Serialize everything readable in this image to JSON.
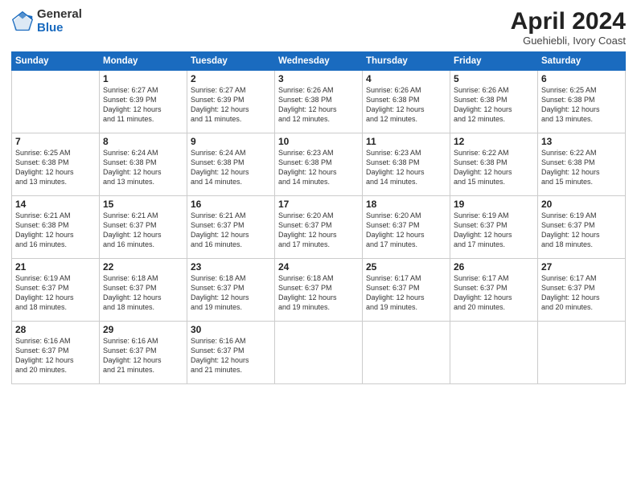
{
  "header": {
    "logo_general": "General",
    "logo_blue": "Blue",
    "month_title": "April 2024",
    "location": "Guehiebli, Ivory Coast"
  },
  "days_of_week": [
    "Sunday",
    "Monday",
    "Tuesday",
    "Wednesday",
    "Thursday",
    "Friday",
    "Saturday"
  ],
  "weeks": [
    [
      {
        "day": "",
        "info": ""
      },
      {
        "day": "1",
        "info": "Sunrise: 6:27 AM\nSunset: 6:39 PM\nDaylight: 12 hours\nand 11 minutes."
      },
      {
        "day": "2",
        "info": "Sunrise: 6:27 AM\nSunset: 6:39 PM\nDaylight: 12 hours\nand 11 minutes."
      },
      {
        "day": "3",
        "info": "Sunrise: 6:26 AM\nSunset: 6:38 PM\nDaylight: 12 hours\nand 12 minutes."
      },
      {
        "day": "4",
        "info": "Sunrise: 6:26 AM\nSunset: 6:38 PM\nDaylight: 12 hours\nand 12 minutes."
      },
      {
        "day": "5",
        "info": "Sunrise: 6:26 AM\nSunset: 6:38 PM\nDaylight: 12 hours\nand 12 minutes."
      },
      {
        "day": "6",
        "info": "Sunrise: 6:25 AM\nSunset: 6:38 PM\nDaylight: 12 hours\nand 13 minutes."
      }
    ],
    [
      {
        "day": "7",
        "info": "Sunrise: 6:25 AM\nSunset: 6:38 PM\nDaylight: 12 hours\nand 13 minutes."
      },
      {
        "day": "8",
        "info": "Sunrise: 6:24 AM\nSunset: 6:38 PM\nDaylight: 12 hours\nand 13 minutes."
      },
      {
        "day": "9",
        "info": "Sunrise: 6:24 AM\nSunset: 6:38 PM\nDaylight: 12 hours\nand 14 minutes."
      },
      {
        "day": "10",
        "info": "Sunrise: 6:23 AM\nSunset: 6:38 PM\nDaylight: 12 hours\nand 14 minutes."
      },
      {
        "day": "11",
        "info": "Sunrise: 6:23 AM\nSunset: 6:38 PM\nDaylight: 12 hours\nand 14 minutes."
      },
      {
        "day": "12",
        "info": "Sunrise: 6:22 AM\nSunset: 6:38 PM\nDaylight: 12 hours\nand 15 minutes."
      },
      {
        "day": "13",
        "info": "Sunrise: 6:22 AM\nSunset: 6:38 PM\nDaylight: 12 hours\nand 15 minutes."
      }
    ],
    [
      {
        "day": "14",
        "info": "Sunrise: 6:21 AM\nSunset: 6:38 PM\nDaylight: 12 hours\nand 16 minutes."
      },
      {
        "day": "15",
        "info": "Sunrise: 6:21 AM\nSunset: 6:37 PM\nDaylight: 12 hours\nand 16 minutes."
      },
      {
        "day": "16",
        "info": "Sunrise: 6:21 AM\nSunset: 6:37 PM\nDaylight: 12 hours\nand 16 minutes."
      },
      {
        "day": "17",
        "info": "Sunrise: 6:20 AM\nSunset: 6:37 PM\nDaylight: 12 hours\nand 17 minutes."
      },
      {
        "day": "18",
        "info": "Sunrise: 6:20 AM\nSunset: 6:37 PM\nDaylight: 12 hours\nand 17 minutes."
      },
      {
        "day": "19",
        "info": "Sunrise: 6:19 AM\nSunset: 6:37 PM\nDaylight: 12 hours\nand 17 minutes."
      },
      {
        "day": "20",
        "info": "Sunrise: 6:19 AM\nSunset: 6:37 PM\nDaylight: 12 hours\nand 18 minutes."
      }
    ],
    [
      {
        "day": "21",
        "info": "Sunrise: 6:19 AM\nSunset: 6:37 PM\nDaylight: 12 hours\nand 18 minutes."
      },
      {
        "day": "22",
        "info": "Sunrise: 6:18 AM\nSunset: 6:37 PM\nDaylight: 12 hours\nand 18 minutes."
      },
      {
        "day": "23",
        "info": "Sunrise: 6:18 AM\nSunset: 6:37 PM\nDaylight: 12 hours\nand 19 minutes."
      },
      {
        "day": "24",
        "info": "Sunrise: 6:18 AM\nSunset: 6:37 PM\nDaylight: 12 hours\nand 19 minutes."
      },
      {
        "day": "25",
        "info": "Sunrise: 6:17 AM\nSunset: 6:37 PM\nDaylight: 12 hours\nand 19 minutes."
      },
      {
        "day": "26",
        "info": "Sunrise: 6:17 AM\nSunset: 6:37 PM\nDaylight: 12 hours\nand 20 minutes."
      },
      {
        "day": "27",
        "info": "Sunrise: 6:17 AM\nSunset: 6:37 PM\nDaylight: 12 hours\nand 20 minutes."
      }
    ],
    [
      {
        "day": "28",
        "info": "Sunrise: 6:16 AM\nSunset: 6:37 PM\nDaylight: 12 hours\nand 20 minutes."
      },
      {
        "day": "29",
        "info": "Sunrise: 6:16 AM\nSunset: 6:37 PM\nDaylight: 12 hours\nand 21 minutes."
      },
      {
        "day": "30",
        "info": "Sunrise: 6:16 AM\nSunset: 6:37 PM\nDaylight: 12 hours\nand 21 minutes."
      },
      {
        "day": "",
        "info": ""
      },
      {
        "day": "",
        "info": ""
      },
      {
        "day": "",
        "info": ""
      },
      {
        "day": "",
        "info": ""
      }
    ]
  ]
}
